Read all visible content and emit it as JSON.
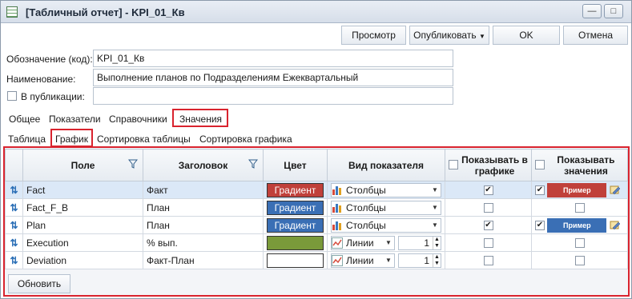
{
  "window": {
    "title": "[Табличный отчет] - KPI_01_Кв"
  },
  "toolbar": {
    "preview": "Просмотр",
    "publish": "Опубликовать",
    "ok": "OK",
    "cancel": "Отмена"
  },
  "form": {
    "code_label": "Обозначение (код):",
    "code_value": "KPI_01_Кв",
    "name_label": "Наименование:",
    "name_value": "Выполнение планов по Подразделениям Ежеквартальный",
    "publications_label": "В публикации:",
    "publications_value": ""
  },
  "main_tabs": [
    "Общее",
    "Показатели",
    "Справочники",
    "Значения"
  ],
  "sub_tabs": [
    "Таблица",
    "График",
    "Сортировка таблицы",
    "Сортировка графика"
  ],
  "grid": {
    "headers": {
      "field": "Поле",
      "title": "Заголовок",
      "color": "Цвет",
      "kind": "Вид показателя",
      "show_chart": "Показывать в графике",
      "show_values": "Показывать значения"
    },
    "rows": [
      {
        "field": "Fact",
        "title": "Факт",
        "color_text": "Градиент",
        "color": "#c0403a",
        "kind": "Столбцы",
        "kind_type": "bars",
        "spin": "",
        "chart": true,
        "values": true,
        "example": "Пример",
        "selected": true
      },
      {
        "field": "Fact_F_B",
        "title": "План",
        "color_text": "Градиент",
        "color": "#3a6fb5",
        "kind": "Столбцы",
        "kind_type": "bars",
        "spin": "",
        "chart": false,
        "values": false,
        "example": "",
        "selected": false
      },
      {
        "field": "Plan",
        "title": "План",
        "color_text": "Градиент",
        "color": "#3a6fb5",
        "kind": "Столбцы",
        "kind_type": "bars",
        "spin": "",
        "chart": true,
        "values": true,
        "example": "Пример",
        "selected": false
      },
      {
        "field": "Execution",
        "title": "% вып.",
        "color_text": "",
        "color": "#7a9a3a",
        "kind": "Линии",
        "kind_type": "lines",
        "spin": "1",
        "chart": false,
        "values": false,
        "example": "",
        "selected": false
      },
      {
        "field": "Deviation",
        "title": "Факт-План",
        "color_text": "",
        "color": "#ffffff",
        "kind": "Линии",
        "kind_type": "lines",
        "spin": "1",
        "chart": false,
        "values": false,
        "example": "",
        "selected": false
      }
    ]
  },
  "refresh_button": "Обновить"
}
